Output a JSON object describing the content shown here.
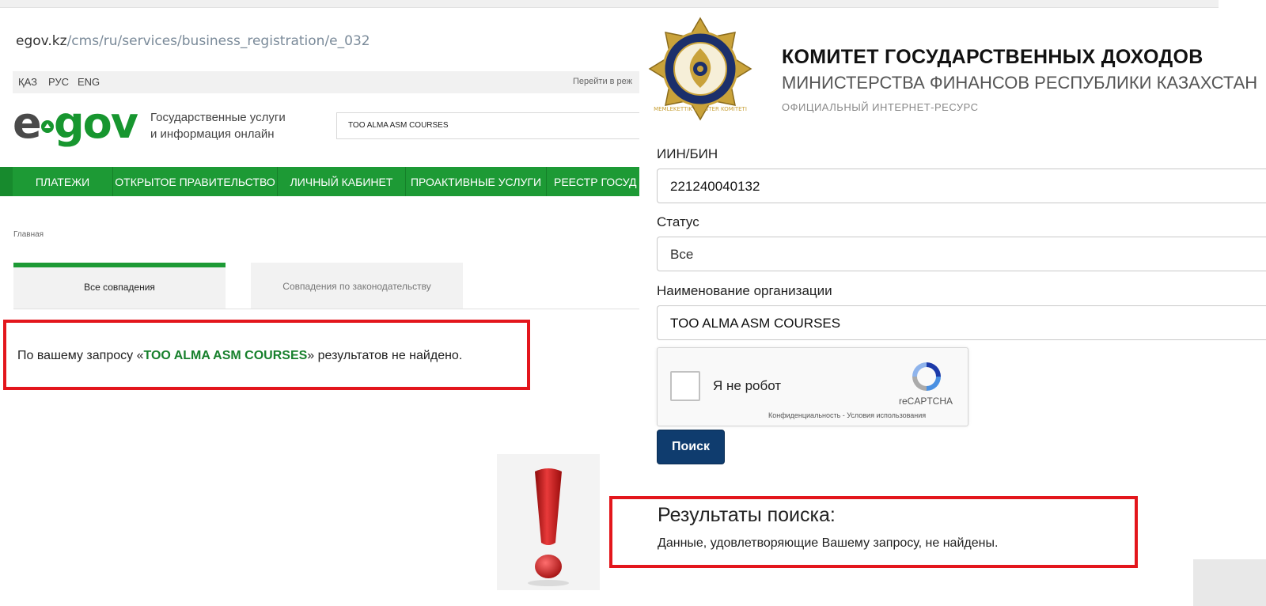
{
  "left": {
    "url": {
      "host": "egov.kz",
      "path": "/cms/ru/services/business_registration/e_032"
    },
    "languages": [
      "ҚАЗ",
      "РУС",
      "ENG"
    ],
    "jump_text": "Перейти в реж",
    "logo": {
      "e": "e",
      "gov": "gov"
    },
    "tagline": [
      "Государственные услуги",
      "и информация онлайн"
    ],
    "search_value": "TOO ALMA ASM COURSES",
    "nav": [
      "ПЛАТЕЖИ",
      "ОТКРЫТОЕ ПРАВИТЕЛЬСТВО",
      "ЛИЧНЫЙ КАБИНЕТ",
      "ПРОАКТИВНЫЕ УСЛУГИ",
      "РЕЕСТР ГОСУД"
    ],
    "breadcrumb": "Главная",
    "tabs": [
      "Все совпадения",
      "Совпадения по законодательству"
    ],
    "noresult": {
      "prefix": "По вашему запросу «",
      "query": "TOO ALMA ASM COURSES",
      "suffix": "» результатов не найдено."
    }
  },
  "right": {
    "title": "КОМИТЕТ ГОСУДАРСТВЕННЫХ ДОХОДОВ",
    "subtitle": "МИНИСТЕРСТВА ФИНАНСОВ РЕСПУБЛИКИ КАЗАХСТАН",
    "note": "ОФИЦИАЛЬНЫЙ ИНТЕРНЕТ-РЕСУРС",
    "emblem_text": "MEMLEKETTIK KIRISTER KOMITETI",
    "fields": [
      {
        "label": "ИИН/БИН",
        "value": "221240040132"
      },
      {
        "label": "Статус",
        "value": "Все"
      },
      {
        "label": "Наименование организации",
        "value": "TOO ALMA ASM COURSES"
      }
    ],
    "captcha": {
      "label": "Я не робот",
      "brand": "reCAPTCHA",
      "terms": "Конфиденциальность - Условия использования"
    },
    "search_button": "Поиск",
    "results_title": "Результаты поиска:",
    "results_text": "Данные, удовлетворяющие Вашему запросу, не найдены."
  },
  "colors": {
    "egov_green": "#1d9a35",
    "alert_red": "#e3161c",
    "button_navy": "#0f3c6e",
    "emblem_gold": "#c9a23a",
    "emblem_blue": "#1b2f6b"
  },
  "icons": [
    "exclamation-icon",
    "recaptcha-icon",
    "checkbox-icon",
    "kgd-emblem"
  ]
}
